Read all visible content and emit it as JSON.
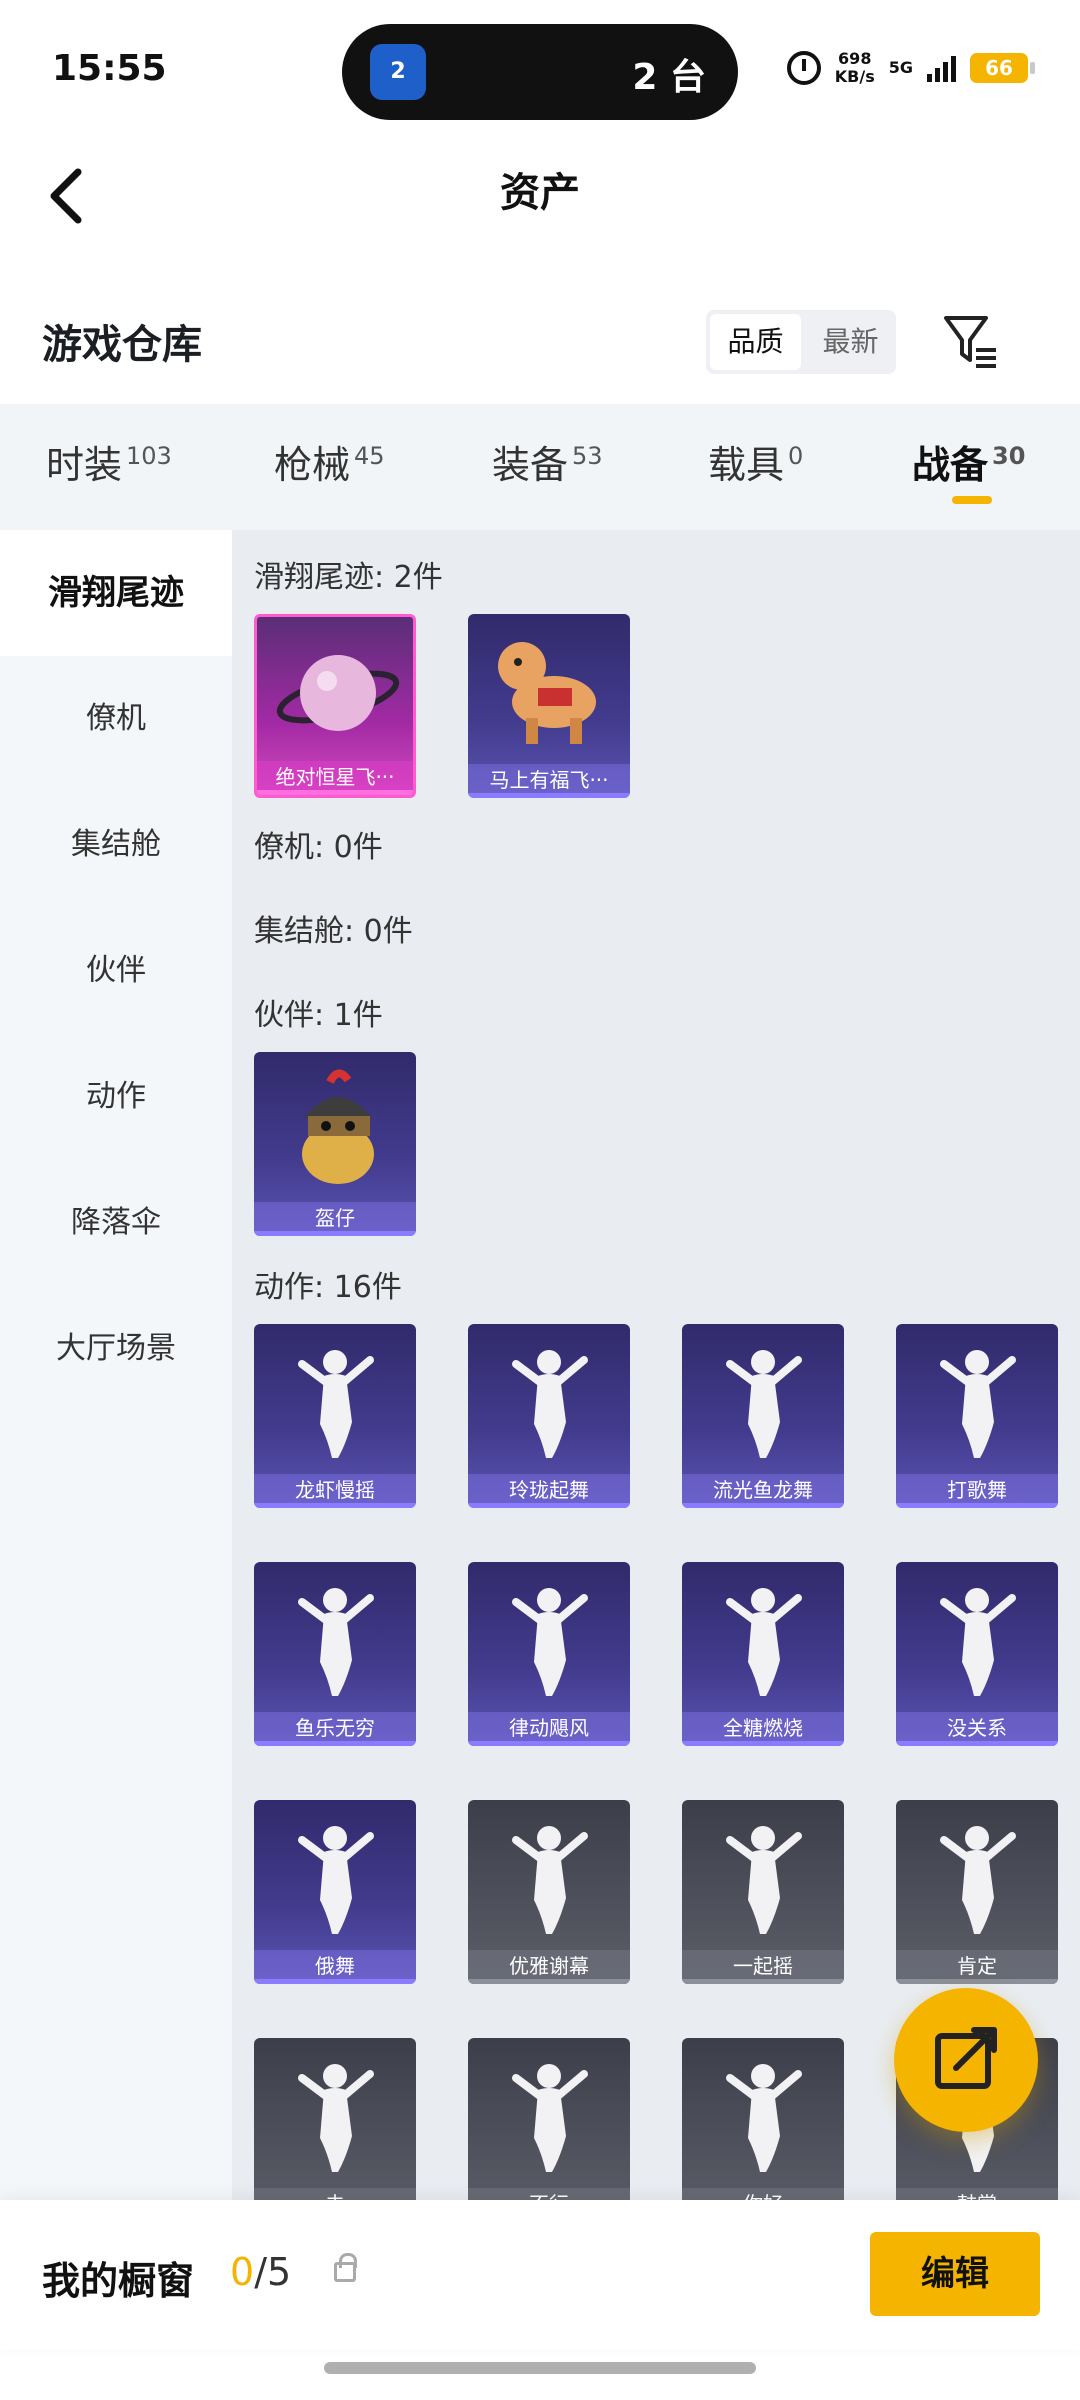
{
  "status_bar": {
    "time": "15:55",
    "island_badge": "2",
    "island_text": "2 台",
    "net_speed": "698",
    "net_unit": "KB/s",
    "net_type": "5G",
    "battery": "66"
  },
  "header": {
    "title": "资产"
  },
  "section": {
    "title": "游戏仓库",
    "sort_options": [
      "品质",
      "最新"
    ],
    "active_sort": "品质"
  },
  "tabs": [
    {
      "label": "时装",
      "count": "103"
    },
    {
      "label": "枪械",
      "count": "45"
    },
    {
      "label": "装备",
      "count": "53"
    },
    {
      "label": "载具",
      "count": "0"
    },
    {
      "label": "战备",
      "count": "30",
      "active": true
    }
  ],
  "left_nav": [
    "滑翔尾迹",
    "僚机",
    "集结舱",
    "伙伴",
    "动作",
    "降落伞",
    "大厅场景"
  ],
  "groups": {
    "glide": {
      "label": "滑翔尾迹: 2件",
      "items": [
        "绝对恒星飞···",
        "马上有福飞···"
      ]
    },
    "wingman": {
      "label": "僚机: 0件"
    },
    "pod": {
      "label": "集结舱: 0件"
    },
    "partner": {
      "label": "伙伴: 1件",
      "items": [
        "盔仔"
      ]
    },
    "emote": {
      "label": "动作: 16件",
      "items": [
        "龙虾慢摇",
        "玲珑起舞",
        "流光鱼龙舞",
        "打歌舞",
        "鱼乐无穷",
        "律动飓风",
        "全糖燃烧",
        "没关系",
        "俄舞",
        "优雅谢幕",
        "一起摇",
        "肯定",
        "去",
        "不行",
        "你好",
        "鼓掌"
      ]
    }
  },
  "bottom_bar": {
    "label": "我的橱窗",
    "count_current": "0",
    "count_total": "/5",
    "edit_label": "编辑"
  },
  "colors": {
    "accent": "#f5b400",
    "card_purple": "#433c8f",
    "card_gray": "#5c5e68",
    "card_pink": "#d24bbd"
  },
  "icons": [
    "back-icon",
    "filter-icon",
    "share-icon",
    "lock-icon",
    "alarm-icon",
    "signal-icon",
    "battery-icon",
    "hotspot-icon"
  ]
}
